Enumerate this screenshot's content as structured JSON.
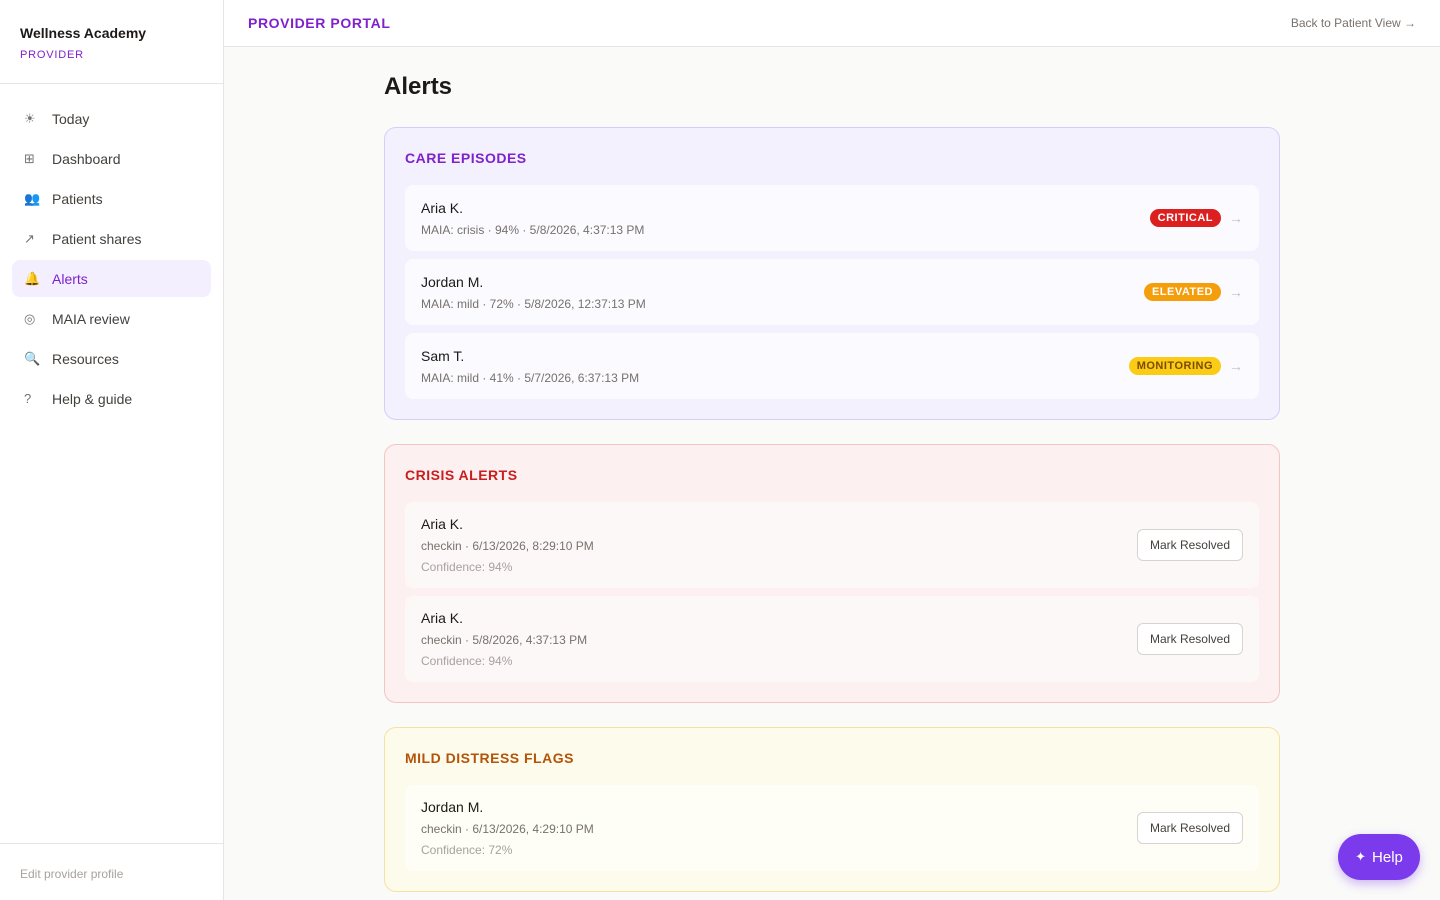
{
  "brand": {
    "name": "Wellness Academy",
    "role": "PROVIDER"
  },
  "nav": [
    {
      "label": "Today",
      "icon": "☀"
    },
    {
      "label": "Dashboard",
      "icon": "⊞"
    },
    {
      "label": "Patients",
      "icon": "👥"
    },
    {
      "label": "Patient shares",
      "icon": "↗"
    },
    {
      "label": "Alerts",
      "icon": "🔔"
    },
    {
      "label": "MAIA review",
      "icon": "◎"
    },
    {
      "label": "Resources",
      "icon": "🔍"
    },
    {
      "label": "Help & guide",
      "icon": "?"
    }
  ],
  "active_nav": "Alerts",
  "sidebar_footer": "Edit provider profile",
  "topbar": {
    "title": "PROVIDER PORTAL",
    "back_link": "Back to Patient View →"
  },
  "page_title": "Alerts",
  "care_episodes": {
    "title": "CARE EPISODES",
    "items": [
      {
        "name": "Aria K.",
        "detail": "MAIA: crisis · 94% · 5/8/2026, 4:37:13 PM",
        "badge": "CRITICAL",
        "arrow": "→"
      },
      {
        "name": "Jordan M.",
        "detail": "MAIA: mild · 72% · 5/8/2026, 12:37:13 PM",
        "badge": "ELEVATED",
        "arrow": "→"
      },
      {
        "name": "Sam T.",
        "detail": "MAIA: mild · 41% · 5/7/2026, 6:37:13 PM",
        "badge": "MONITORING",
        "arrow": "→"
      }
    ]
  },
  "crisis_alerts": {
    "title": "CRISIS ALERTS",
    "items": [
      {
        "name": "Aria K.",
        "detail": "checkin · 6/13/2026, 8:29:10 PM",
        "confidence": "Confidence: 94%",
        "action": "Mark Resolved"
      },
      {
        "name": "Aria K.",
        "detail": "checkin · 5/8/2026, 4:37:13 PM",
        "confidence": "Confidence: 94%",
        "action": "Mark Resolved"
      }
    ]
  },
  "mild_flags": {
    "title": "MILD DISTRESS FLAGS",
    "items": [
      {
        "name": "Jordan M.",
        "detail": "checkin · 6/13/2026, 4:29:10 PM",
        "confidence": "Confidence: 72%",
        "action": "Mark Resolved"
      }
    ]
  },
  "help_button": {
    "icon": "✦",
    "label": "Help"
  },
  "colors": {
    "accent": "#7e22ce",
    "critical": "#dc1f1f",
    "elevated": "#f59e0b",
    "monitoring": "#facc15",
    "fab": "#7c3aed"
  }
}
